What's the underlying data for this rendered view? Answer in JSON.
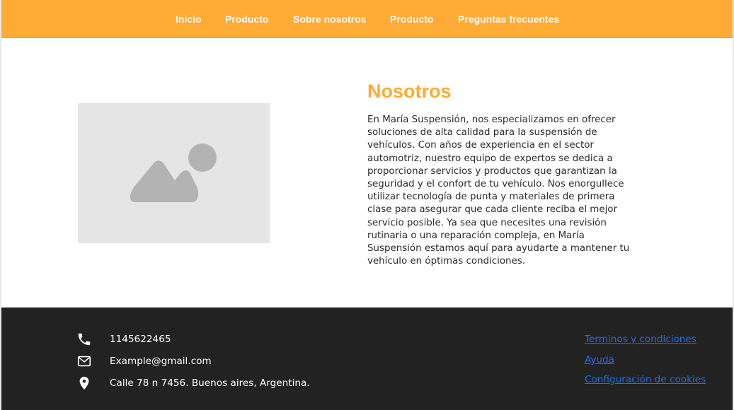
{
  "nav": {
    "items": [
      {
        "label": "Inicio"
      },
      {
        "label": "Producto"
      },
      {
        "label": "Sobre nosotros"
      },
      {
        "label": "Producto"
      },
      {
        "label": "Preguntas frecuentes"
      }
    ]
  },
  "about": {
    "title": "Nosotros",
    "text": "En María Suspensión, nos especializamos en ofrecer soluciones de alta calidad para la suspensión de vehículos. Con años de experiencia en el sector automotriz, nuestro equipo de expertos se dedica a proporcionar servicios y productos que garantizan la seguridad y el confort de tu vehículo. Nos enorgullece utilizar tecnología de punta y materiales de primera clase para asegurar que cada cliente reciba el mejor servicio posible. Ya sea que necesites una revisión rutinaria o una reparación compleja, en María Suspensión estamos aquí para ayudarte a mantener tu vehículo en óptimas condiciones.",
    "image_icon": "image-placeholder-icon"
  },
  "footer": {
    "contacts": [
      {
        "icon": "phone-icon",
        "text": "1145622465"
      },
      {
        "icon": "mail-icon",
        "text": "Example@gmail.com"
      },
      {
        "icon": "location-pin-icon",
        "text": "Calle 78 n 7456. Buenos aires, Argentina."
      }
    ],
    "links": [
      {
        "label": "Terminos y condiciones"
      },
      {
        "label": "Ayuda"
      },
      {
        "label": "Configuración de cookies"
      }
    ]
  },
  "colors": {
    "accent": "#ffab36",
    "footer_bg": "#222222",
    "link": "#1f6fe0",
    "placeholder_bg": "#e5e5e5",
    "placeholder_fg": "#b3b3b3"
  }
}
